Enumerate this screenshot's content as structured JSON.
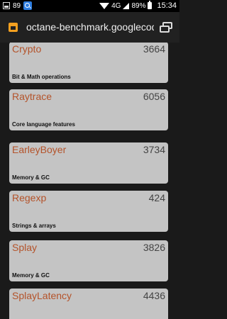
{
  "status_bar": {
    "left_count": "89",
    "battery_text": "89%",
    "network": "4G",
    "time": "15:34"
  },
  "toolbar": {
    "url": "octane-benchmark.googlecode"
  },
  "results": [
    {
      "name": "Crypto",
      "score": "3664",
      "description": "Bit & Math operations"
    },
    {
      "name": "Raytrace",
      "score": "6056",
      "description": "Core language features"
    },
    {
      "name": "EarleyBoyer",
      "score": "3734",
      "description": "Memory & GC"
    },
    {
      "name": "Regexp",
      "score": "424",
      "description": "Strings & arrays"
    },
    {
      "name": "Splay",
      "score": "3826",
      "description": "Memory & GC"
    },
    {
      "name": "SplayLatency",
      "score": "4436",
      "description": ""
    }
  ]
}
